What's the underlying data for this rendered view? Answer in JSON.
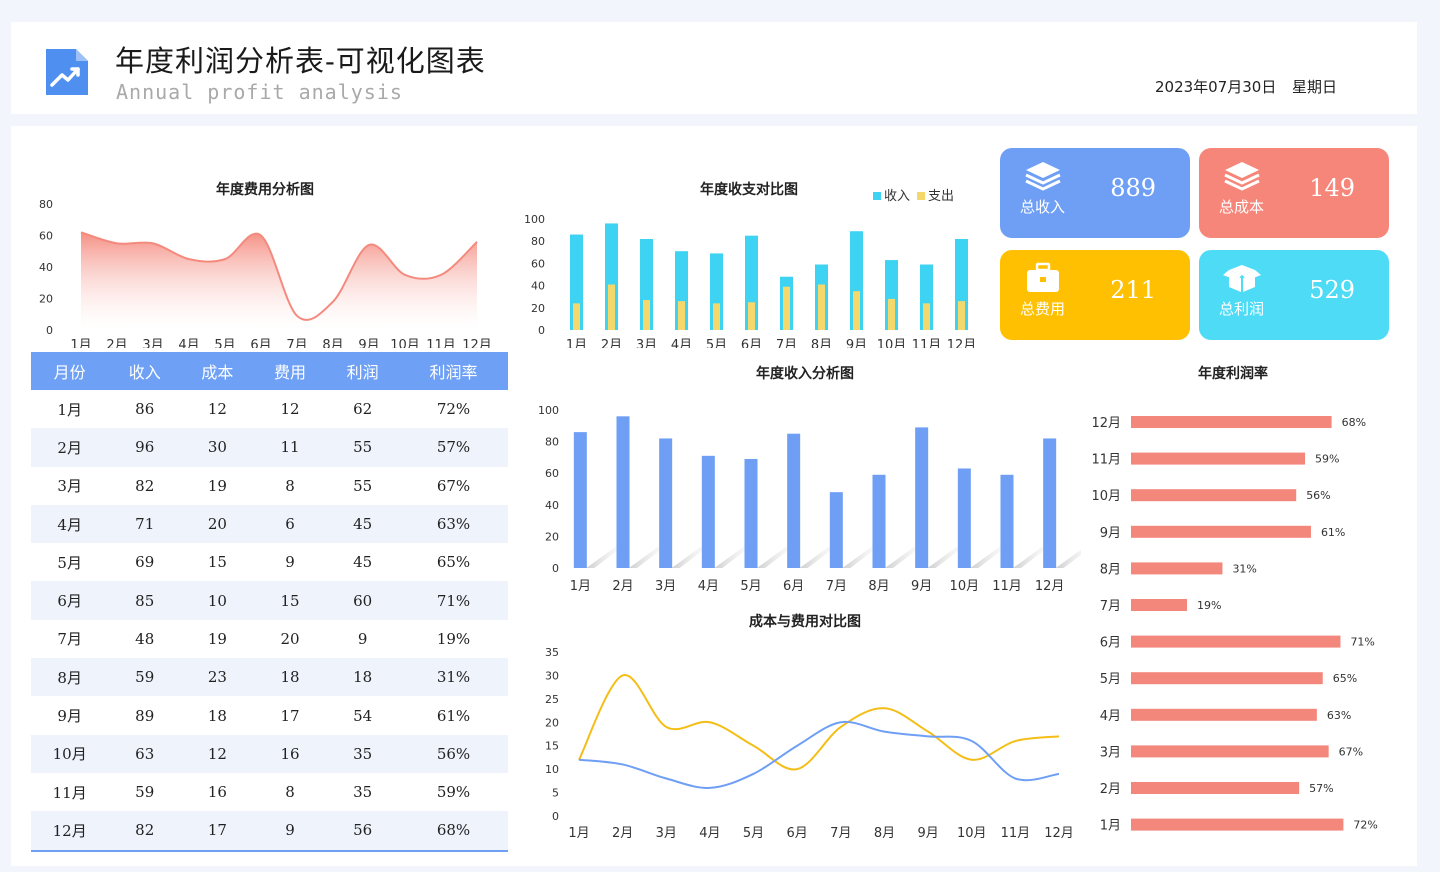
{
  "header": {
    "title": "年度利润分析表-可视化图表",
    "subtitle": "Annual profit analysis",
    "date": "2023年07月30日",
    "weekday": "星期日"
  },
  "kpis": [
    {
      "label": "总收入",
      "value": "889",
      "color": "#6e9ff5",
      "icon": "stack-layers-icon"
    },
    {
      "label": "总成本",
      "value": "149",
      "color": "#f7867a",
      "icon": "stack-layers-icon"
    },
    {
      "label": "总费用",
      "value": "211",
      "color": "#fec000",
      "icon": "briefcase-icon"
    },
    {
      "label": "总利润",
      "value": "529",
      "color": "#4ddbf5",
      "icon": "box-icon"
    }
  ],
  "table": {
    "headers": [
      "月份",
      "收入",
      "成本",
      "费用",
      "利润",
      "利润率"
    ],
    "rows": [
      [
        "1月",
        "86",
        "12",
        "12",
        "62",
        "72%"
      ],
      [
        "2月",
        "96",
        "30",
        "11",
        "55",
        "57%"
      ],
      [
        "3月",
        "82",
        "19",
        "8",
        "55",
        "67%"
      ],
      [
        "4月",
        "71",
        "20",
        "6",
        "45",
        "63%"
      ],
      [
        "5月",
        "69",
        "15",
        "9",
        "45",
        "65%"
      ],
      [
        "6月",
        "85",
        "10",
        "15",
        "60",
        "71%"
      ],
      [
        "7月",
        "48",
        "19",
        "20",
        "9",
        "19%"
      ],
      [
        "8月",
        "59",
        "23",
        "18",
        "18",
        "31%"
      ],
      [
        "9月",
        "89",
        "18",
        "17",
        "54",
        "61%"
      ],
      [
        "10月",
        "63",
        "12",
        "16",
        "35",
        "56%"
      ],
      [
        "11月",
        "59",
        "16",
        "8",
        "35",
        "59%"
      ],
      [
        "12月",
        "82",
        "17",
        "9",
        "56",
        "68%"
      ]
    ]
  },
  "chart_data": [
    {
      "id": "expense",
      "type": "area",
      "title": "年度费用分析图",
      "categories": [
        "1月",
        "2月",
        "3月",
        "4月",
        "5月",
        "6月",
        "7月",
        "8月",
        "9月",
        "10月",
        "11月",
        "12月"
      ],
      "values": [
        62,
        55,
        55,
        45,
        45,
        60,
        9,
        18,
        54,
        35,
        35,
        56
      ],
      "ylim": [
        0,
        80
      ],
      "yticks": [
        0,
        20,
        40,
        60,
        80
      ],
      "color": "#f48a7e"
    },
    {
      "id": "income-expense",
      "type": "bar",
      "title": "年度收支对比图",
      "categories": [
        "1月",
        "2月",
        "3月",
        "4月",
        "5月",
        "6月",
        "7月",
        "8月",
        "9月",
        "10月",
        "11月",
        "12月"
      ],
      "series": [
        {
          "name": "收入",
          "values": [
            86,
            96,
            82,
            71,
            69,
            85,
            48,
            59,
            89,
            63,
            59,
            82
          ],
          "color": "#3fd3f3"
        },
        {
          "name": "支出",
          "values": [
            24,
            41,
            27,
            26,
            24,
            25,
            39,
            41,
            35,
            28,
            24,
            26
          ],
          "color": "#f5d86b"
        }
      ],
      "ylim": [
        0,
        100
      ],
      "yticks": [
        0,
        20,
        40,
        60,
        80,
        100
      ],
      "legend": "top-right"
    },
    {
      "id": "income",
      "type": "bar",
      "title": "年度收入分析图",
      "categories": [
        "1月",
        "2月",
        "3月",
        "4月",
        "5月",
        "6月",
        "7月",
        "8月",
        "9月",
        "10月",
        "11月",
        "12月"
      ],
      "values": [
        86,
        96,
        82,
        71,
        69,
        85,
        48,
        59,
        89,
        63,
        59,
        82
      ],
      "ylim": [
        0,
        100
      ],
      "yticks": [
        0,
        20,
        40,
        60,
        80,
        100
      ],
      "color": "#6e9ff5"
    },
    {
      "id": "cost-expense",
      "type": "line",
      "title": "成本与费用对比图",
      "categories": [
        "1月",
        "2月",
        "3月",
        "4月",
        "5月",
        "6月",
        "7月",
        "8月",
        "9月",
        "10月",
        "11月",
        "12月"
      ],
      "series": [
        {
          "values": [
            12,
            30,
            19,
            20,
            15,
            10,
            19,
            23,
            18,
            12,
            16,
            17
          ],
          "color": "#f4be17"
        },
        {
          "values": [
            12,
            11,
            8,
            6,
            9,
            15,
            20,
            18,
            17,
            16,
            8,
            9
          ],
          "color": "#6e9ff5"
        }
      ],
      "ylim": [
        0,
        35
      ],
      "yticks": [
        0,
        5,
        10,
        15,
        20,
        25,
        30,
        35
      ]
    },
    {
      "id": "margin",
      "type": "bar",
      "orientation": "horizontal",
      "title": "年度利润率",
      "categories": [
        "12月",
        "11月",
        "10月",
        "9月",
        "8月",
        "7月",
        "6月",
        "5月",
        "4月",
        "3月",
        "2月",
        "1月"
      ],
      "values": [
        68,
        59,
        56,
        61,
        31,
        19,
        71,
        65,
        63,
        67,
        57,
        72
      ],
      "labels": [
        "68%",
        "59%",
        "56%",
        "61%",
        "31%",
        "19%",
        "71%",
        "65%",
        "63%",
        "67%",
        "57%",
        "72%"
      ],
      "color": "#f4877b"
    }
  ]
}
